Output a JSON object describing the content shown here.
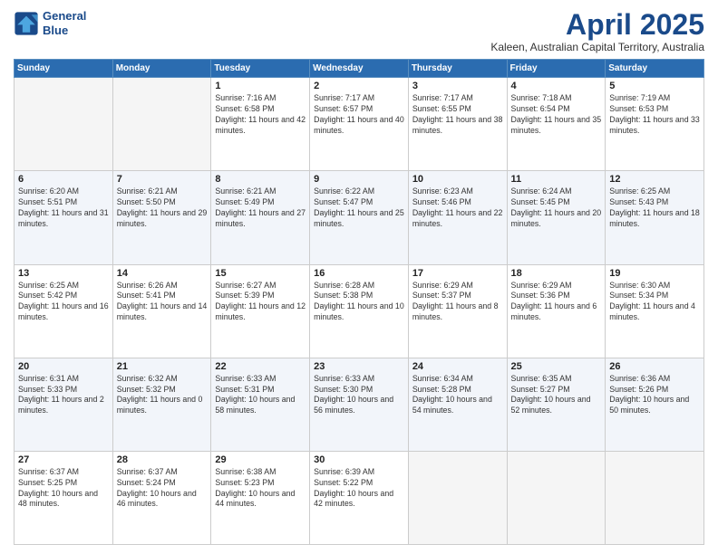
{
  "header": {
    "logo_line1": "General",
    "logo_line2": "Blue",
    "month": "April 2025",
    "location": "Kaleen, Australian Capital Territory, Australia"
  },
  "weekdays": [
    "Sunday",
    "Monday",
    "Tuesday",
    "Wednesday",
    "Thursday",
    "Friday",
    "Saturday"
  ],
  "weeks": [
    [
      {
        "day": "",
        "info": ""
      },
      {
        "day": "",
        "info": ""
      },
      {
        "day": "1",
        "info": "Sunrise: 7:16 AM\nSunset: 6:58 PM\nDaylight: 11 hours and 42 minutes."
      },
      {
        "day": "2",
        "info": "Sunrise: 7:17 AM\nSunset: 6:57 PM\nDaylight: 11 hours and 40 minutes."
      },
      {
        "day": "3",
        "info": "Sunrise: 7:17 AM\nSunset: 6:55 PM\nDaylight: 11 hours and 38 minutes."
      },
      {
        "day": "4",
        "info": "Sunrise: 7:18 AM\nSunset: 6:54 PM\nDaylight: 11 hours and 35 minutes."
      },
      {
        "day": "5",
        "info": "Sunrise: 7:19 AM\nSunset: 6:53 PM\nDaylight: 11 hours and 33 minutes."
      }
    ],
    [
      {
        "day": "6",
        "info": "Sunrise: 6:20 AM\nSunset: 5:51 PM\nDaylight: 11 hours and 31 minutes."
      },
      {
        "day": "7",
        "info": "Sunrise: 6:21 AM\nSunset: 5:50 PM\nDaylight: 11 hours and 29 minutes."
      },
      {
        "day": "8",
        "info": "Sunrise: 6:21 AM\nSunset: 5:49 PM\nDaylight: 11 hours and 27 minutes."
      },
      {
        "day": "9",
        "info": "Sunrise: 6:22 AM\nSunset: 5:47 PM\nDaylight: 11 hours and 25 minutes."
      },
      {
        "day": "10",
        "info": "Sunrise: 6:23 AM\nSunset: 5:46 PM\nDaylight: 11 hours and 22 minutes."
      },
      {
        "day": "11",
        "info": "Sunrise: 6:24 AM\nSunset: 5:45 PM\nDaylight: 11 hours and 20 minutes."
      },
      {
        "day": "12",
        "info": "Sunrise: 6:25 AM\nSunset: 5:43 PM\nDaylight: 11 hours and 18 minutes."
      }
    ],
    [
      {
        "day": "13",
        "info": "Sunrise: 6:25 AM\nSunset: 5:42 PM\nDaylight: 11 hours and 16 minutes."
      },
      {
        "day": "14",
        "info": "Sunrise: 6:26 AM\nSunset: 5:41 PM\nDaylight: 11 hours and 14 minutes."
      },
      {
        "day": "15",
        "info": "Sunrise: 6:27 AM\nSunset: 5:39 PM\nDaylight: 11 hours and 12 minutes."
      },
      {
        "day": "16",
        "info": "Sunrise: 6:28 AM\nSunset: 5:38 PM\nDaylight: 11 hours and 10 minutes."
      },
      {
        "day": "17",
        "info": "Sunrise: 6:29 AM\nSunset: 5:37 PM\nDaylight: 11 hours and 8 minutes."
      },
      {
        "day": "18",
        "info": "Sunrise: 6:29 AM\nSunset: 5:36 PM\nDaylight: 11 hours and 6 minutes."
      },
      {
        "day": "19",
        "info": "Sunrise: 6:30 AM\nSunset: 5:34 PM\nDaylight: 11 hours and 4 minutes."
      }
    ],
    [
      {
        "day": "20",
        "info": "Sunrise: 6:31 AM\nSunset: 5:33 PM\nDaylight: 11 hours and 2 minutes."
      },
      {
        "day": "21",
        "info": "Sunrise: 6:32 AM\nSunset: 5:32 PM\nDaylight: 11 hours and 0 minutes."
      },
      {
        "day": "22",
        "info": "Sunrise: 6:33 AM\nSunset: 5:31 PM\nDaylight: 10 hours and 58 minutes."
      },
      {
        "day": "23",
        "info": "Sunrise: 6:33 AM\nSunset: 5:30 PM\nDaylight: 10 hours and 56 minutes."
      },
      {
        "day": "24",
        "info": "Sunrise: 6:34 AM\nSunset: 5:28 PM\nDaylight: 10 hours and 54 minutes."
      },
      {
        "day": "25",
        "info": "Sunrise: 6:35 AM\nSunset: 5:27 PM\nDaylight: 10 hours and 52 minutes."
      },
      {
        "day": "26",
        "info": "Sunrise: 6:36 AM\nSunset: 5:26 PM\nDaylight: 10 hours and 50 minutes."
      }
    ],
    [
      {
        "day": "27",
        "info": "Sunrise: 6:37 AM\nSunset: 5:25 PM\nDaylight: 10 hours and 48 minutes."
      },
      {
        "day": "28",
        "info": "Sunrise: 6:37 AM\nSunset: 5:24 PM\nDaylight: 10 hours and 46 minutes."
      },
      {
        "day": "29",
        "info": "Sunrise: 6:38 AM\nSunset: 5:23 PM\nDaylight: 10 hours and 44 minutes."
      },
      {
        "day": "30",
        "info": "Sunrise: 6:39 AM\nSunset: 5:22 PM\nDaylight: 10 hours and 42 minutes."
      },
      {
        "day": "",
        "info": ""
      },
      {
        "day": "",
        "info": ""
      },
      {
        "day": "",
        "info": ""
      }
    ]
  ]
}
